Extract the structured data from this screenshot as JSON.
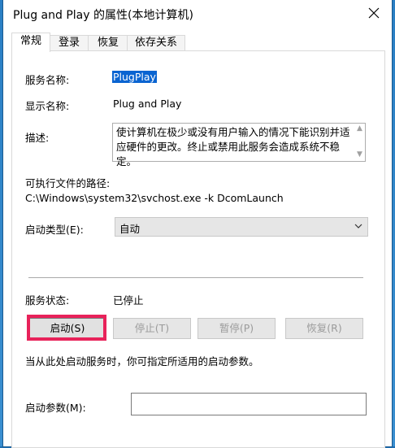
{
  "window": {
    "title": "Plug and Play 的属性(本地计算机)"
  },
  "tabs": [
    {
      "label": "常规",
      "active": true
    },
    {
      "label": "登录",
      "active": false
    },
    {
      "label": "恢复",
      "active": false
    },
    {
      "label": "依存关系",
      "active": false
    }
  ],
  "general": {
    "service_name_label": "服务名称:",
    "service_name": "PlugPlay",
    "display_name_label": "显示名称:",
    "display_name": "Plug and Play",
    "description_label": "描述:",
    "description": "使计算机在极少或没有用户输入的情况下能识别并适应硬件的更改。终止或禁用此服务会造成系统不稳定。",
    "path_label": "可执行文件的路径:",
    "path": "C:\\Windows\\system32\\svchost.exe -k DcomLaunch",
    "startup_type_label": "启动类型(E):",
    "startup_type": "自动",
    "status_label": "服务状态:",
    "status": "已停止",
    "buttons": {
      "start": "启动(S)",
      "stop": "停止(T)",
      "pause": "暂停(P)",
      "resume": "恢复(R)"
    },
    "hint": "当从此处启动服务时，你可指定所适用的启动参数。",
    "start_params_label": "启动参数(M):",
    "start_params": ""
  },
  "colors": {
    "selection": "#0a64d1",
    "highlight": "#e8225a"
  }
}
